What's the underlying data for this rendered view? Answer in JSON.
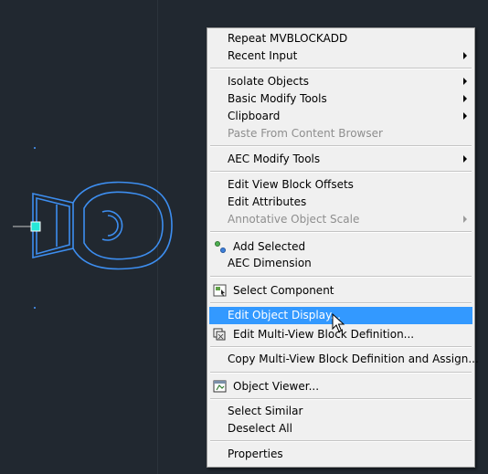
{
  "menu": {
    "repeat": "Repeat MVBLOCKADD",
    "recent_input": "Recent Input",
    "isolate_objects": "Isolate Objects",
    "basic_modify_tools": "Basic Modify Tools",
    "clipboard": "Clipboard",
    "paste_from_content_browser": "Paste From Content Browser",
    "aec_modify_tools": "AEC Modify Tools",
    "edit_view_block_offsets": "Edit View Block Offsets",
    "edit_attributes": "Edit Attributes",
    "annotative_object_scale": "Annotative Object Scale",
    "add_selected": "Add Selected",
    "aec_dimension": "AEC Dimension",
    "select_component": "Select Component",
    "edit_object_display": "Edit Object Display...",
    "edit_multi_view_block_definition": "Edit Multi-View Block Definition...",
    "copy_multi_view_block_definition": "Copy Multi-View Block Definition and Assign...",
    "object_viewer": "Object Viewer...",
    "select_similar": "Select Similar",
    "deselect_all": "Deselect All",
    "properties": "Properties"
  },
  "colors": {
    "canvas_background": "#212830",
    "selection_highlight": "#3399ff",
    "block_outline": "#3d8ef0",
    "grip": "#27e8d8"
  }
}
